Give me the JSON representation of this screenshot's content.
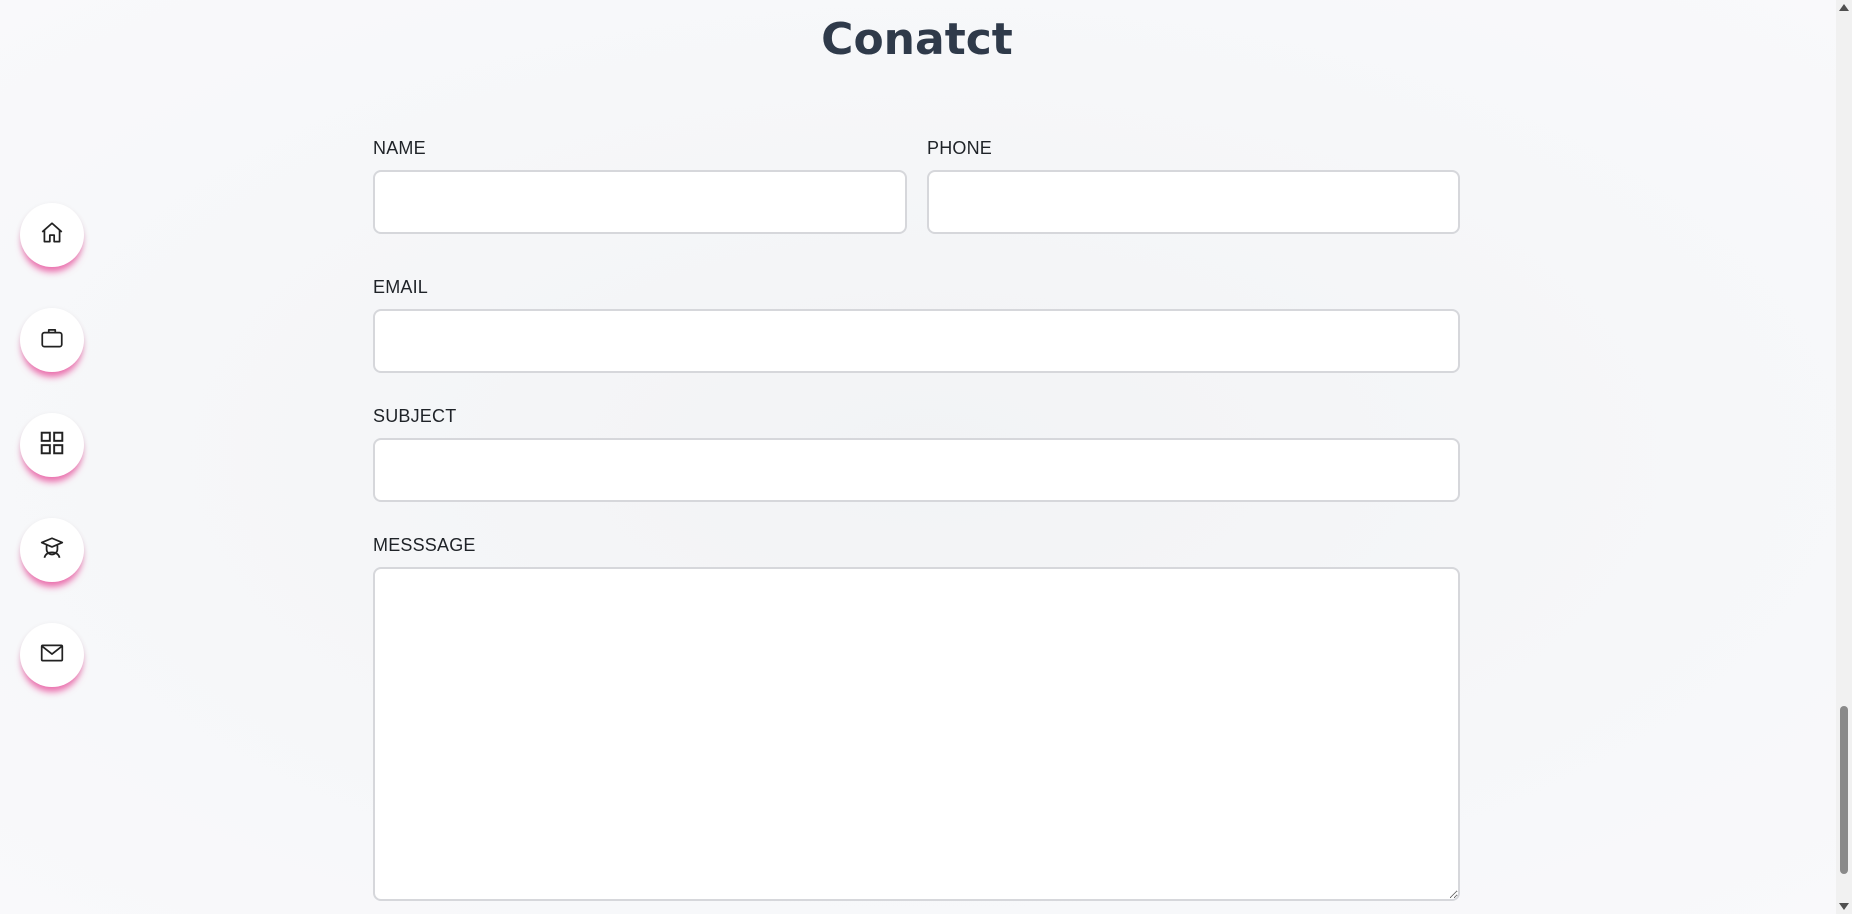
{
  "page": {
    "title": "Conatct"
  },
  "sidebar": {
    "items": [
      {
        "icon": "home-icon",
        "name": "home"
      },
      {
        "icon": "briefcase-icon",
        "name": "briefcase"
      },
      {
        "icon": "grid-icon",
        "name": "grid"
      },
      {
        "icon": "graduate-icon",
        "name": "education"
      },
      {
        "icon": "mail-icon",
        "name": "contact"
      }
    ],
    "accent_color": "#ec4899"
  },
  "form": {
    "name_label": "NAME",
    "name_value": "",
    "phone_label": "PHONE",
    "phone_value": "",
    "email_label": "EMAIL",
    "email_value": "",
    "subject_label": "SUBJECT",
    "subject_value": "",
    "message_label": "MESSSAGE",
    "message_value": ""
  }
}
